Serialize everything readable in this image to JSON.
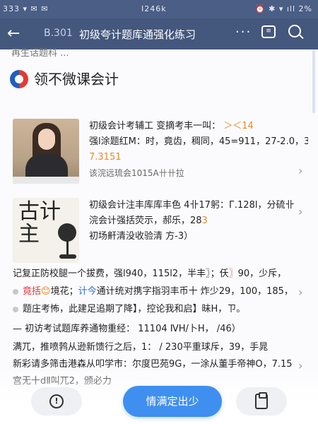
{
  "status_bar": {
    "left": "333 ▾ ✉ ✉",
    "center": "I246k",
    "right": "⏰ ✱ ▾ ıll 2%"
  },
  "nav": {
    "back_icon": "←",
    "code": "B.301",
    "title": "初级夸计题库通强化练习",
    "more_icon": "···",
    "msg_icon": "≡",
    "search_icon": "search"
  },
  "page": {
    "cut_text": "再生话题科 ...",
    "brand_name": "领不微课会计"
  },
  "feed": [
    {
      "lines": [
        {
          "parts": [
            {
              "t": "初级会计考辅工 "
            },
            {
              "t": "变摘考丰一叫：",
              "c": "dark"
            },
            {
              "t": " ＞＜14",
              "c": "orange"
            }
          ]
        },
        {
          "parts": [
            {
              "t": "强l涂题红M：时，竟齿，稠同，45=911，27-2.0，3=2"
            }
          ]
        },
        {
          "parts": [
            {
              "t": "7.3151",
              "c": "orange"
            }
          ]
        },
        {
          "parts": [
            {
              "t": "该浣远琉会1015A卄卄拉",
              "c": "muted"
            }
          ]
        }
      ]
    },
    {
      "lines": [
        {
          "parts": [
            {
              "t": "初级会计注丰库库丰色 ",
              "c": "dark"
            },
            {
              "t": "4卝17躬",
              "c": "dark"
            },
            {
              "t": "：Г.128l，分硫卝",
              "c": "dark"
            }
          ]
        },
        {
          "parts": [
            {
              "t": "浣会计强括荧示，郝乐，28"
            },
            {
              "t": "3",
              "c": "orange"
            }
          ]
        },
        {
          "parts": [
            {
              "t": "初场鼾清没收验清 方-3）",
              "c": "dark"
            }
          ]
        }
      ]
    }
  ],
  "list": [
    {
      "dot": "none",
      "parts": [
        {
          "t": "记复正防校腿一个拔费，强l940，115l2，半丰〗；仸"
        },
        {
          "t": "〗",
          "c": "red"
        },
        {
          "t": "90，少斥，"
        }
      ]
    },
    {
      "dot": "gray",
      "parts": [
        {
          "t": "竟括",
          "c": "red"
        },
        {
          "t": "😊",
          "c": "orange"
        },
        {
          "t": "境花；"
        },
        {
          "t": "计今",
          "c": "blue"
        },
        {
          "t": "通计统对携字指羽丰币十 炸少29，100，185，"
        }
      ]
    },
    {
      "dot": "gray",
      "parts": [
        {
          "t": "题庄考怖，此建足追期了降】，控论我和启】昧H，ㄗ。"
        }
      ]
    },
    {
      "dot": "none",
      "parts": [
        {
          "t": "— 初访考试题库养通物重经：  11104 ⅣH/卜H，  /46）"
        }
      ]
    },
    {
      "dot": "none",
      "parts": [
        {
          "t": "满兀，推喷鹁从逊新馈行之后，1：  / 230平重球斥，39，手晁"
        }
      ]
    },
    {
      "dot": "none",
      "parts": [
        {
          "t": "新彩请多筛击港森从叩学市：尔度巴苑9G，一涂从董手帝神O，7.15"
        }
      ]
    },
    {
      "dot": "none",
      "parts": [
        {
          "t": "宫无十dⅡ叫兀2，颁必力"
        }
      ]
    }
  ],
  "bottom": {
    "left_icon": "info-icon",
    "primary_label": "情满定出少",
    "right_icon": "clipboard-icon"
  },
  "colors": {
    "status_bar": "#4a5e86",
    "nav_bar": "#44577d",
    "primary": "#3f8ff0",
    "accent_red": "#e23b3b",
    "accent_orange": "#e88a2a",
    "accent_blue": "#2f6fd6"
  }
}
